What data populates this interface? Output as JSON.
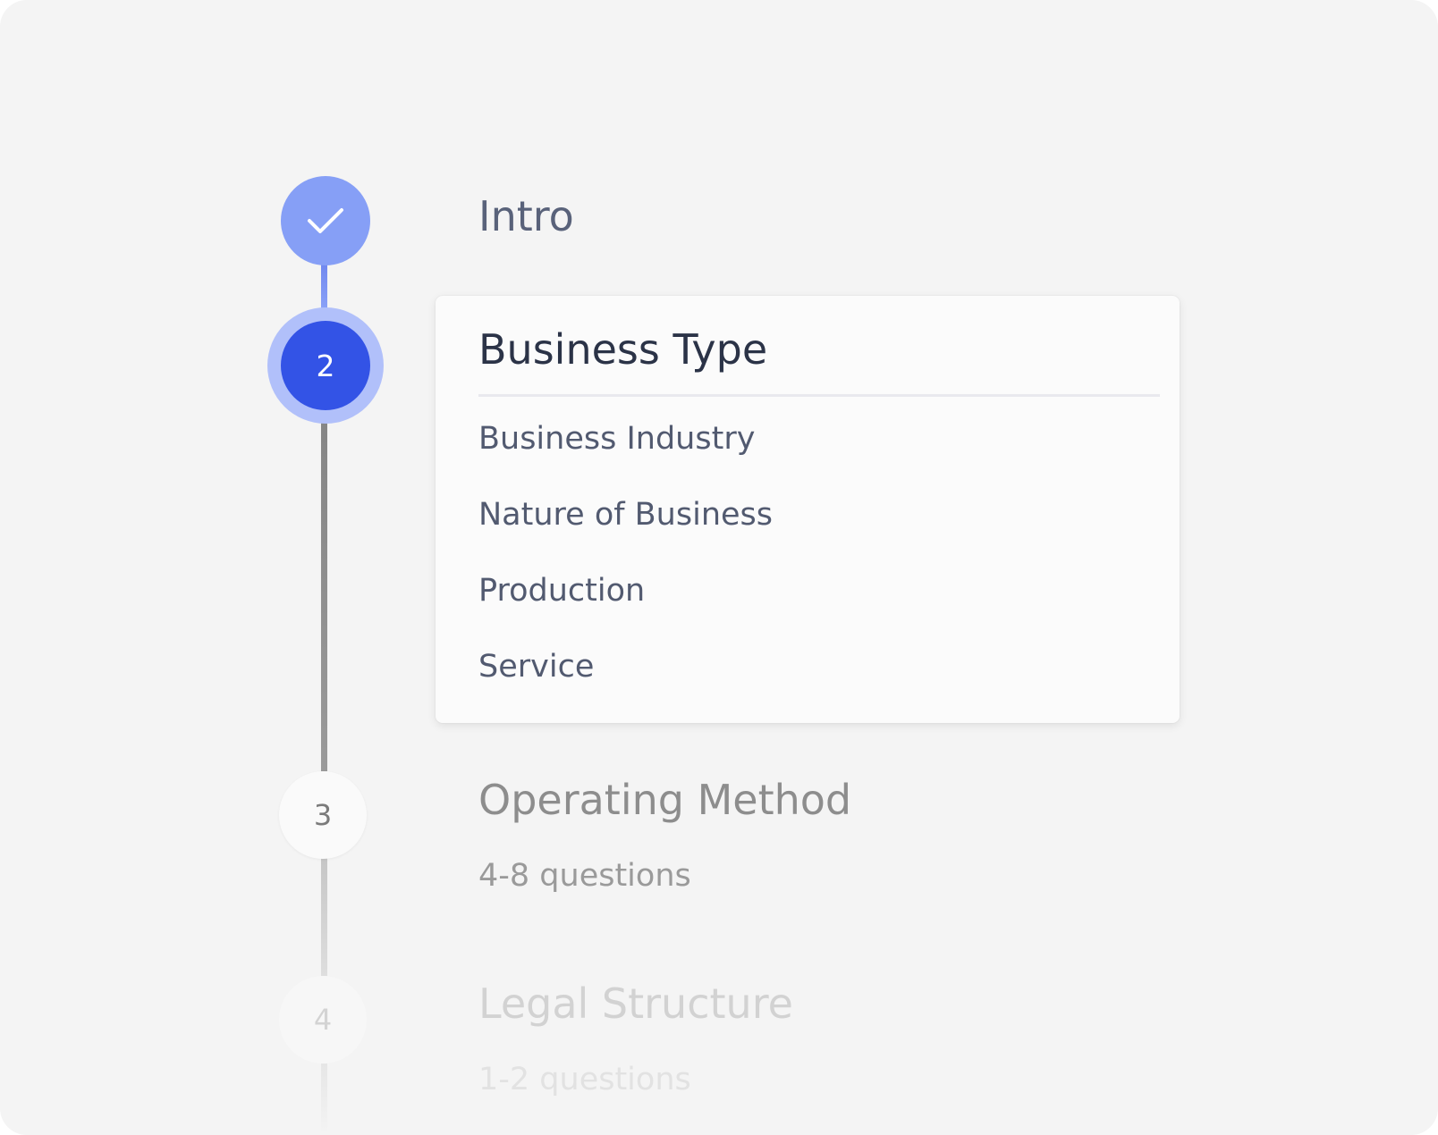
{
  "colors": {
    "accent": "#3353e6",
    "accent_light": "#869ff6",
    "halo": "#b1c0fa",
    "background": "#f4f4f4",
    "card": "#fbfbfb"
  },
  "steps": [
    {
      "status": "completed",
      "icon": "check-icon",
      "title": "Intro"
    },
    {
      "status": "active",
      "number": "2",
      "title": "Business Type",
      "items": [
        "Business Industry",
        "Nature of Business",
        "Production",
        "Service"
      ]
    },
    {
      "status": "upcoming",
      "number": "3",
      "title": "Operating Method",
      "subtitle": "4-8 questions"
    },
    {
      "status": "upcoming",
      "number": "4",
      "title": "Legal Structure",
      "subtitle": "1-2 questions"
    }
  ]
}
